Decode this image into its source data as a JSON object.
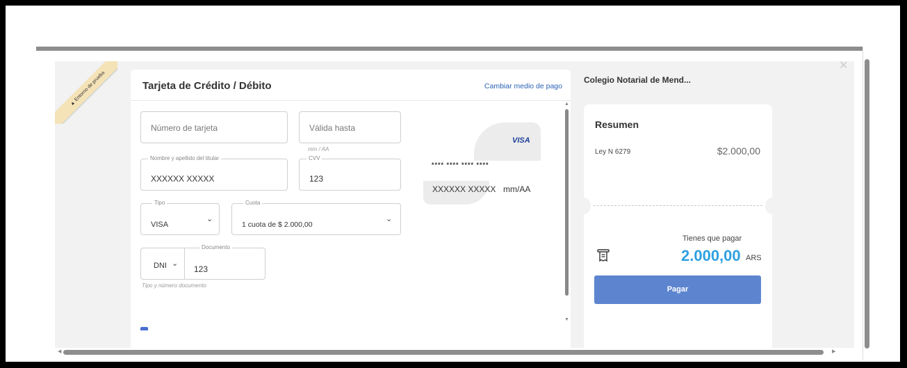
{
  "env_ribbon": "Entorno de prueba",
  "card_form": {
    "title": "Tarjeta de Crédito / Débito",
    "change_link": "Cambiar medio de pago",
    "card_number_placeholder": "Número de tarjeta",
    "expiry_placeholder": "Válida hasta",
    "expiry_hint": "mm / AA",
    "holder_label": "Nombre y apellido del titular",
    "holder_value": "XXXXXX XXXXX",
    "cvv_label": "CVV",
    "cvv_value": "123",
    "type_label": "Tipo",
    "type_value": "VISA",
    "installments_label": "Cuota",
    "installments_value": "1 cuota de $ 2.000,00",
    "document_label": "Documento",
    "doc_type_value": "DNI",
    "doc_number_value": "123",
    "doc_hint": "Tipo y número documento"
  },
  "card_preview": {
    "brand": "VISA",
    "masked_number": "****  ****  ****  ****",
    "holder": "XXXXXX XXXXX",
    "expiry": "mm/AA"
  },
  "merchant": {
    "name": "Colegio Notarial de Mend..."
  },
  "summary": {
    "title": "Resumen",
    "item_label": "Ley N 6279",
    "item_amount": "$2.000,00",
    "pay_label": "Tienes que pagar",
    "pay_amount": "2.000,00",
    "currency": "ARS",
    "pay_button": "Pagar"
  },
  "icons": {
    "close": "close-icon",
    "receipt": "receipt-icon",
    "chevron": "chevron-down-icon"
  },
  "colors": {
    "accent_blue": "#2fa0e0",
    "button_blue": "#5d85cf",
    "link_blue": "#2b62b4"
  }
}
